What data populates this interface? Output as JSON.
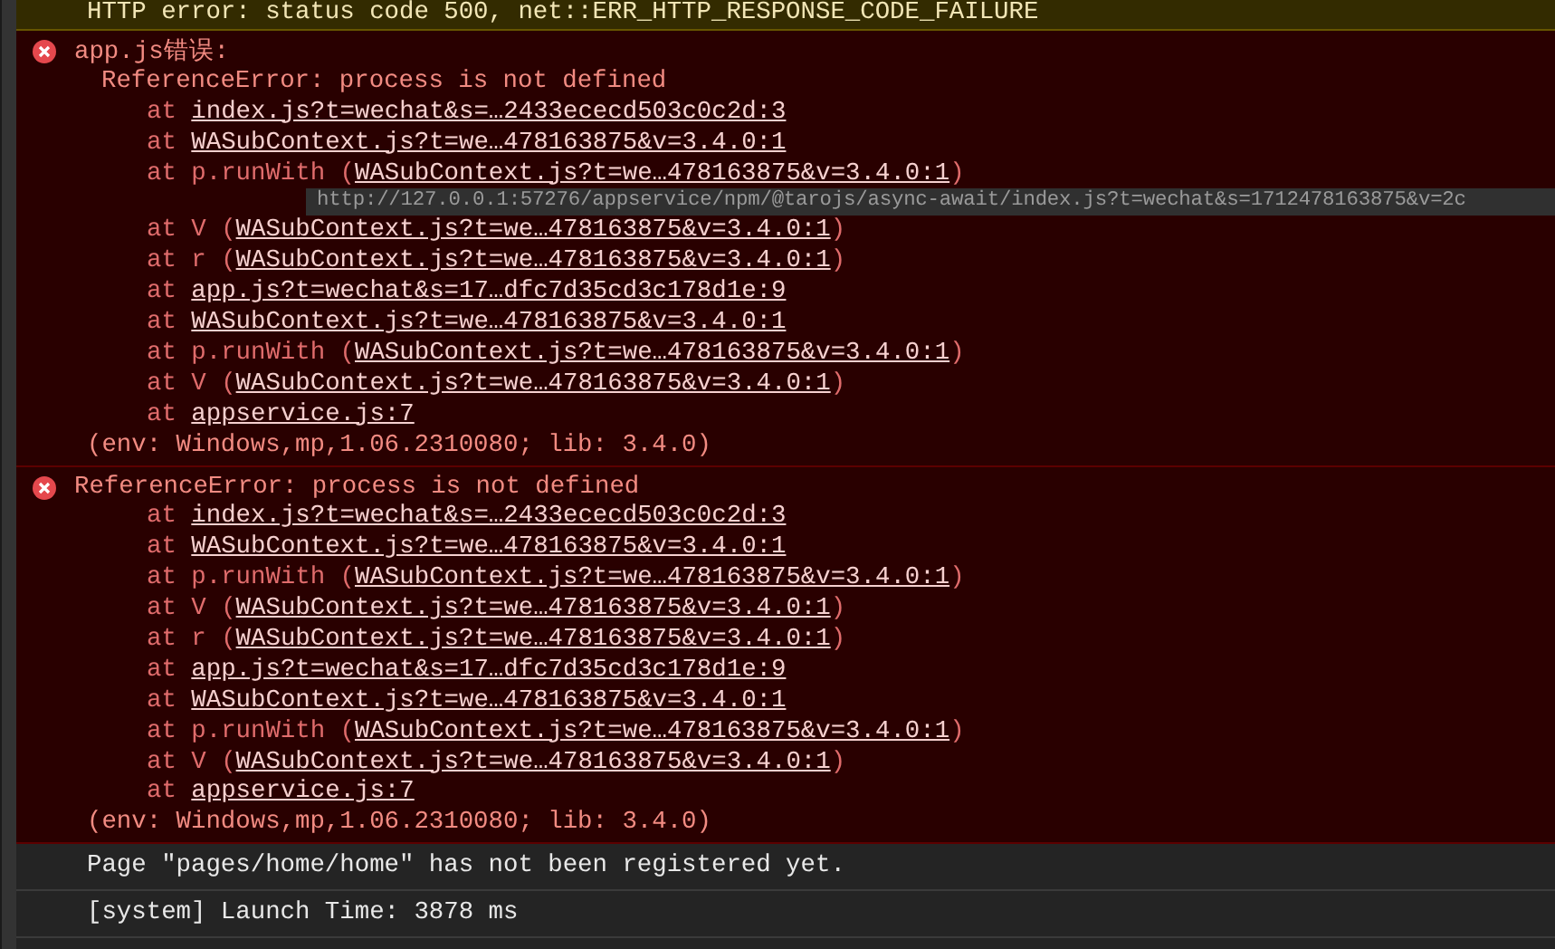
{
  "entries": [
    {
      "kind": "warning",
      "message": "HTTP error: status code 500, net::ERR_HTTP_RESPONSE_CODE_FAILURE"
    },
    {
      "kind": "error",
      "title": "app.js错误:",
      "message": "ReferenceError: process is not defined",
      "stack": [
        {
          "prefix": "at ",
          "link": "index.js?t=wechat&s=…2433ececd503c0c2d:3"
        },
        {
          "prefix": "at ",
          "link": "WASubContext.js?t=we…478163875&v=3.4.0:1"
        },
        {
          "prefix": "at p.runWith (",
          "link": "WASubContext.js?t=we…478163875&v=3.4.0:1",
          "suffix": ")",
          "tooltip": "http://127.0.0.1:57276/appservice/npm/@tarojs/async-await/index.js?t=wechat&s=1712478163875&v=2c"
        },
        {
          "prefix": "at V (",
          "link": "WASubContext.js?t=we…478163875&v=3.4.0:1",
          "suffix": ")"
        },
        {
          "prefix": "at r (",
          "link": "WASubContext.js?t=we…478163875&v=3.4.0:1",
          "suffix": ")"
        },
        {
          "prefix": "at ",
          "link": "app.js?t=wechat&s=17…dfc7d35cd3c178d1e:9"
        },
        {
          "prefix": "at ",
          "link": "WASubContext.js?t=we…478163875&v=3.4.0:1"
        },
        {
          "prefix": "at p.runWith (",
          "link": "WASubContext.js?t=we…478163875&v=3.4.0:1",
          "suffix": ")"
        },
        {
          "prefix": "at V (",
          "link": "WASubContext.js?t=we…478163875&v=3.4.0:1",
          "suffix": ")"
        },
        {
          "prefix": "at ",
          "link": "appservice.js:7"
        }
      ],
      "env": "(env: Windows,mp,1.06.2310080; lib: 3.4.0)"
    },
    {
      "kind": "error",
      "message": "ReferenceError: process is not defined",
      "stack": [
        {
          "prefix": "at ",
          "link": "index.js?t=wechat&s=…2433ececd503c0c2d:3"
        },
        {
          "prefix": "at ",
          "link": "WASubContext.js?t=we…478163875&v=3.4.0:1"
        },
        {
          "prefix": "at p.runWith (",
          "link": "WASubContext.js?t=we…478163875&v=3.4.0:1",
          "suffix": ")"
        },
        {
          "prefix": "at V (",
          "link": "WASubContext.js?t=we…478163875&v=3.4.0:1",
          "suffix": ")"
        },
        {
          "prefix": "at r (",
          "link": "WASubContext.js?t=we…478163875&v=3.4.0:1",
          "suffix": ")"
        },
        {
          "prefix": "at ",
          "link": "app.js?t=wechat&s=17…dfc7d35cd3c178d1e:9"
        },
        {
          "prefix": "at ",
          "link": "WASubContext.js?t=we…478163875&v=3.4.0:1"
        },
        {
          "prefix": "at p.runWith (",
          "link": "WASubContext.js?t=we…478163875&v=3.4.0:1",
          "suffix": ")"
        },
        {
          "prefix": "at V (",
          "link": "WASubContext.js?t=we…478163875&v=3.4.0:1",
          "suffix": ")"
        },
        {
          "prefix": "at ",
          "link": "appservice.js:7"
        }
      ],
      "env": "(env: Windows,mp,1.06.2310080; lib: 3.4.0)"
    },
    {
      "kind": "log",
      "message": "Page \"pages/home/home\" has not been registered yet."
    },
    {
      "kind": "log",
      "message": "[system] Launch Time: 3878 ms"
    }
  ]
}
